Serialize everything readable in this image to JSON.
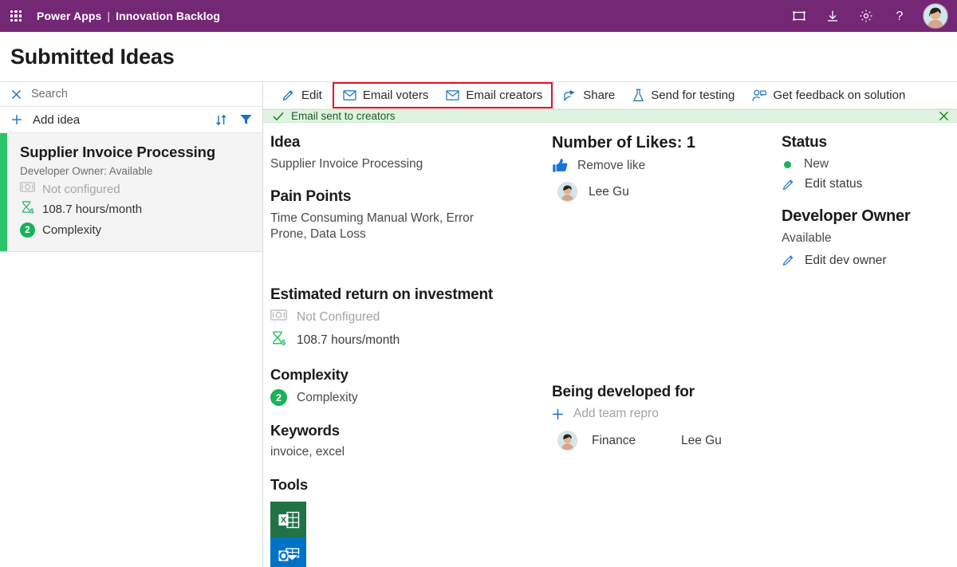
{
  "topbar": {
    "waffle_icon": "app-launcher-icon",
    "brand": "Power Apps",
    "divider": "|",
    "app_name": "Innovation Backlog",
    "icons": [
      {
        "name": "fullscreen-icon",
        "title": "Fullscreen"
      },
      {
        "name": "download-icon",
        "title": "Download"
      },
      {
        "name": "gear-icon",
        "title": "Settings"
      },
      {
        "name": "help-icon",
        "title": "Help"
      }
    ],
    "avatar_name": "user-avatar"
  },
  "page": {
    "title": "Submitted Ideas"
  },
  "sidebar": {
    "search": {
      "label": "Search",
      "clear_icon": "close-icon"
    },
    "add_idea": {
      "label": "Add idea",
      "icon": "plus-icon"
    },
    "sort_icon": "sort-icon",
    "filter_icon": "filter-icon",
    "cards": [
      {
        "title": "Supplier Invoice Processing",
        "subtitle": "Developer Owner: Available",
        "money_icon": "money-bill-icon",
        "money_value": "Not configured",
        "hours_icon": "hourglass-dollar-icon",
        "hours_value": "108.7 hours/month",
        "complexity_badge": "2",
        "complexity_label": "Complexity",
        "accent_color": "#2cc36b"
      }
    ]
  },
  "commandbar": {
    "edit": {
      "label": "Edit",
      "icon": "pencil-icon"
    },
    "email_voters": {
      "label": "Email voters",
      "icon": "mail-icon"
    },
    "email_creators": {
      "label": "Email creators",
      "icon": "mail-icon"
    },
    "share": {
      "label": "Share",
      "icon": "share-icon"
    },
    "send_for_testing": {
      "label": "Send for testing",
      "icon": "flask-icon"
    },
    "get_feedback": {
      "label": "Get feedback on solution",
      "icon": "feedback-person-icon"
    },
    "highlight_color": "#e81123"
  },
  "notification": {
    "check_icon": "check-icon",
    "message": "Email sent to creators",
    "close_icon": "close-icon",
    "background": "#dff3e0"
  },
  "details": {
    "idea": {
      "heading": "Idea",
      "value": "Supplier Invoice Processing"
    },
    "pain_points": {
      "heading": "Pain Points",
      "value": "Time Consuming Manual Work, Error Prone, Data Loss"
    },
    "roi": {
      "heading": "Estimated return on investment",
      "money_icon": "money-bill-icon",
      "money_value": "Not Configured",
      "hours_icon": "hourglass-dollar-icon",
      "hours_value": "108.7 hours/month"
    },
    "complexity": {
      "heading": "Complexity",
      "badge": "2",
      "label": "Complexity"
    },
    "keywords": {
      "heading": "Keywords",
      "value": "invoice, excel"
    },
    "tools": {
      "heading": "Tools",
      "items": [
        {
          "name": "excel-icon",
          "label": "Excel",
          "color": "#217346"
        },
        {
          "name": "outlook-icon",
          "label": "Outlook",
          "color": "#0072c6"
        }
      ]
    }
  },
  "likes": {
    "heading": "Number of Likes: 1",
    "action": {
      "label": "Remove like",
      "icon": "thumbs-up-icon"
    },
    "voters": [
      {
        "name": "Lee Gu",
        "avatar": "avatar-lee-gu"
      }
    ]
  },
  "developed_for": {
    "heading": "Being developed for",
    "add": {
      "label": "Add team repro",
      "icon": "plus-icon"
    },
    "teams": [
      {
        "team": "Finance",
        "owner": "Lee Gu",
        "avatar": "avatar-lee-gu"
      }
    ]
  },
  "status": {
    "heading": "Status",
    "value": "New",
    "dot_color": "#19b257",
    "edit": {
      "label": "Edit status",
      "icon": "pencil-icon"
    }
  },
  "developer_owner": {
    "heading": "Developer Owner",
    "value": "Available",
    "edit": {
      "label": "Edit dev owner",
      "icon": "pencil-icon"
    }
  }
}
